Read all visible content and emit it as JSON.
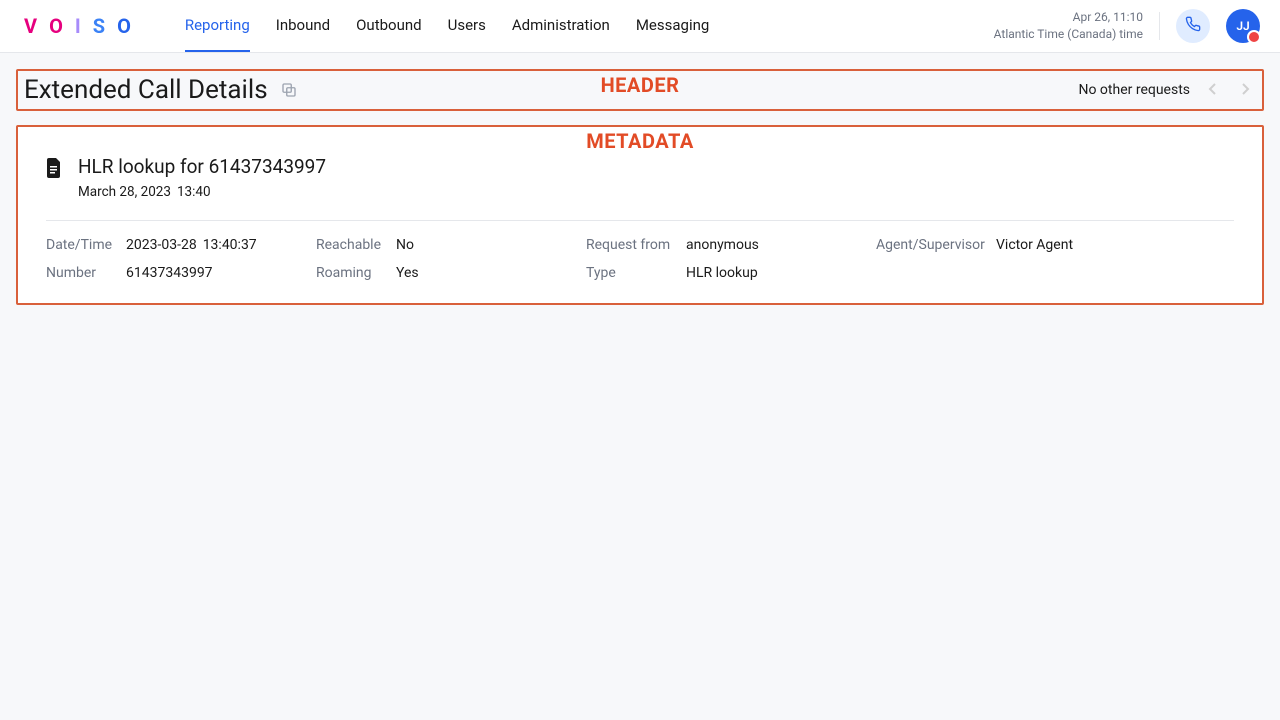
{
  "nav": {
    "items": [
      "Reporting",
      "Inbound",
      "Outbound",
      "Users",
      "Administration",
      "Messaging"
    ],
    "activeIndex": 0
  },
  "topright": {
    "datetime": "Apr 26, 11:10",
    "tz": "Atlantic Time (Canada) time",
    "avatarInitials": "JJ"
  },
  "header": {
    "title": "Extended Call Details",
    "rightText": "No other requests",
    "annotationLabel": "HEADER"
  },
  "metadata": {
    "annotationLabel": "METADATA",
    "title": "HLR lookup for 61437343997",
    "subDate": "March 28, 2023",
    "subTime": "13:40",
    "fields": {
      "datetime_label": "Date/Time",
      "datetime_date": "2023-03-28",
      "datetime_time": "13:40:37",
      "number_label": "Number",
      "number_value": "61437343997",
      "reachable_label": "Reachable",
      "reachable_value": "No",
      "roaming_label": "Roaming",
      "roaming_value": "Yes",
      "reqfrom_label": "Request from",
      "reqfrom_value": "anonymous",
      "type_label": "Type",
      "type_value": "HLR lookup",
      "agent_label": "Agent/Supervisor",
      "agent_value": "Victor Agent"
    }
  }
}
